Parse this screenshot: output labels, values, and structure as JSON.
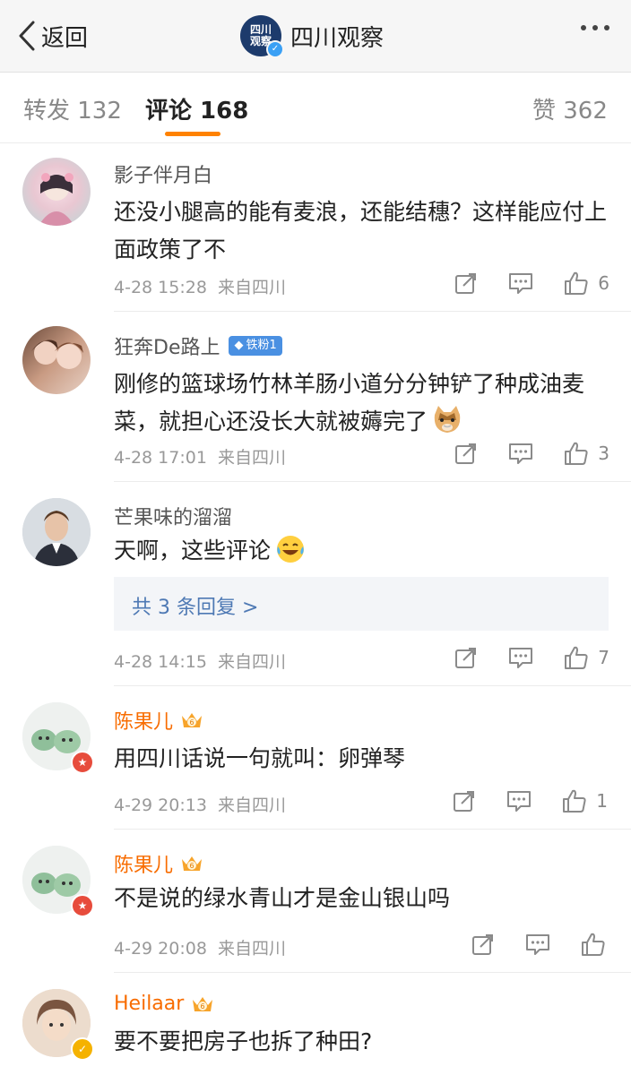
{
  "header": {
    "back_label": "返回",
    "account_logo_text": "四川观察",
    "title": "四川观察"
  },
  "tabs": [
    {
      "label": "转发 132",
      "active": false
    },
    {
      "label": "评论 168",
      "active": true
    },
    {
      "label": "赞 362",
      "active": false
    }
  ],
  "colors": {
    "accent": "#ff8200",
    "vip_name": "#f86c00",
    "link": "#4e79b4"
  },
  "comments": [
    {
      "user": "影子伴月白",
      "text": "还没小腿高的能有麦浪，还能结穗？这样能应付上面政策了不",
      "time": "4-28 15:28",
      "source": "来自四川",
      "likes": "6"
    },
    {
      "user": "狂奔De路上",
      "fan_badge": "铁粉1",
      "text": "刚修的篮球场竹林羊肠小道分分钟铲了种成油麦菜，就担心还没长大就被薅完了",
      "emoji": "cat-face-emoji",
      "time": "4-28 17:01",
      "source": "来自四川",
      "likes": "3"
    },
    {
      "user": "芒果味的溜溜",
      "text": "天啊，这些评论",
      "emoji": "laughing-crying-emoji",
      "replies_label": "共 3 条回复 >",
      "time": "4-28 14:15",
      "source": "来自四川",
      "likes": "7"
    },
    {
      "user": "陈果儿",
      "vip": true,
      "text": "用四川话说一句就叫：卵弹琴",
      "time": "4-29 20:13",
      "source": "来自四川",
      "likes": "1"
    },
    {
      "user": "陈果儿",
      "vip": true,
      "text": "不是说的绿水青山才是金山银山吗",
      "time": "4-29 20:08",
      "source": "来自四川",
      "likes": ""
    },
    {
      "user": "Heilaar",
      "vip": true,
      "text": "要不要把房子也拆了种田?",
      "time": "",
      "source": "",
      "likes": ""
    }
  ]
}
